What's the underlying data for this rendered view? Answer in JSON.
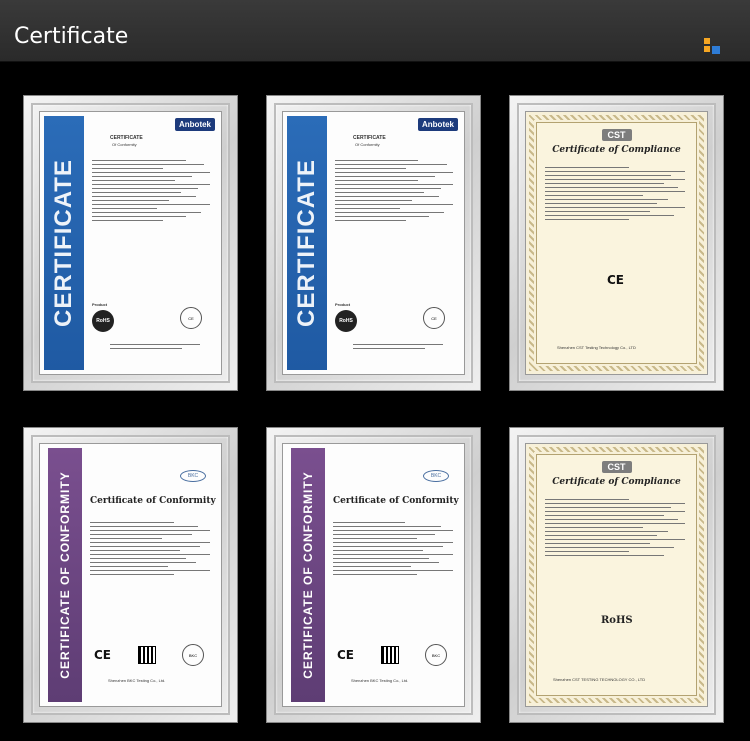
{
  "header": {
    "title": "Certificate",
    "logo_colors": [
      "#f5a623",
      "#2e7cd6"
    ]
  },
  "certificates": [
    {
      "style": "blue",
      "side_text": "CERTIFICATE",
      "brand": "Anbotek",
      "heading_1": "CERTIFICATE",
      "heading_2": "Of Conformity",
      "product_label": "Product",
      "rohs": "RoHS"
    },
    {
      "style": "blue",
      "side_text": "CERTIFICATE",
      "brand": "Anbotek",
      "heading_1": "CERTIFICATE",
      "heading_2": "Of Conformity",
      "product_label": "Product",
      "rohs": "RoHS"
    },
    {
      "style": "cst",
      "logo": "CST",
      "title": "Certificate of Compliance",
      "ce": "CE",
      "footer": "Shenzhen CST Testing Technology Co., LTD"
    },
    {
      "style": "purple",
      "side_text": "CERTIFICATE OF CONFORMITY",
      "logo": "BKC",
      "title": "Certificate of Conformity",
      "ce": "CE",
      "footer": "Shenzhen BKC Testing Co., Ltd."
    },
    {
      "style": "purple",
      "side_text": "CERTIFICATE OF CONFORMITY",
      "logo": "BKC",
      "title": "Certificate of Conformity",
      "ce": "CE",
      "footer": "Shenzhen BKC Testing Co., Ltd."
    },
    {
      "style": "cst",
      "logo": "CST",
      "title": "Certificate of Compliance",
      "rohs": "RoHS",
      "footer": "Shenzhen CST TESTING TECHNOLOGY CO., LTD"
    }
  ]
}
